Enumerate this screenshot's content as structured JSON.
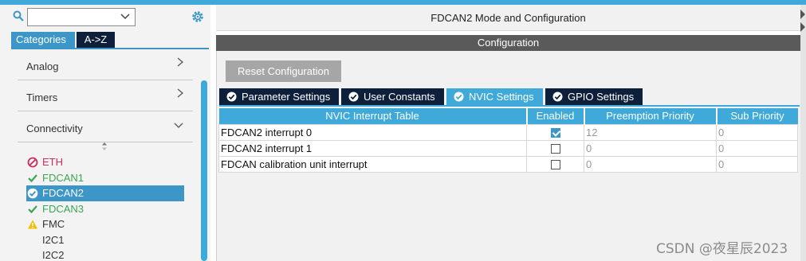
{
  "sidebar": {
    "search": {
      "value": ""
    },
    "category_tabs": [
      "Categories",
      "A->Z"
    ],
    "categories": [
      {
        "label": "Analog",
        "state": "collapsed"
      },
      {
        "label": "Timers",
        "state": "collapsed"
      },
      {
        "label": "Connectivity",
        "state": "expanded"
      }
    ],
    "peripherals": [
      {
        "label": "ETH",
        "status": "disabled"
      },
      {
        "label": "FDCAN1",
        "status": "ok"
      },
      {
        "label": "FDCAN2",
        "status": "selected"
      },
      {
        "label": "FDCAN3",
        "status": "ok"
      },
      {
        "label": "FMC",
        "status": "warning"
      },
      {
        "label": "I2C1",
        "status": "none"
      },
      {
        "label": "I2C2",
        "status": "none"
      }
    ]
  },
  "main": {
    "title": "FDCAN2 Mode and Configuration",
    "config_header": "Configuration",
    "reset_button": "Reset Configuration",
    "tabs": [
      {
        "label": "Parameter Settings",
        "active": false
      },
      {
        "label": "User Constants",
        "active": false
      },
      {
        "label": "NVIC Settings",
        "active": true
      },
      {
        "label": "GPIO Settings",
        "active": false
      }
    ],
    "table": {
      "headers": [
        "NVIC Interrupt Table",
        "Enabled",
        "Preemption Priority",
        "Sub Priority"
      ],
      "rows": [
        {
          "name": "FDCAN2 interrupt 0",
          "enabled": true,
          "preemption": "12",
          "sub": "0"
        },
        {
          "name": "FDCAN2 interrupt 1",
          "enabled": false,
          "preemption": "0",
          "sub": "0"
        },
        {
          "name": "FDCAN calibration unit interrupt",
          "enabled": false,
          "preemption": "0",
          "sub": "0"
        }
      ]
    }
  },
  "watermark": "CSDN @夜星辰2023",
  "colors": {
    "accent": "#3fa9d9",
    "dark_tab": "#0e1f3c",
    "ok_green": "#3aa655",
    "disabled_red": "#c8305a",
    "warning_yellow": "#f0c000"
  }
}
